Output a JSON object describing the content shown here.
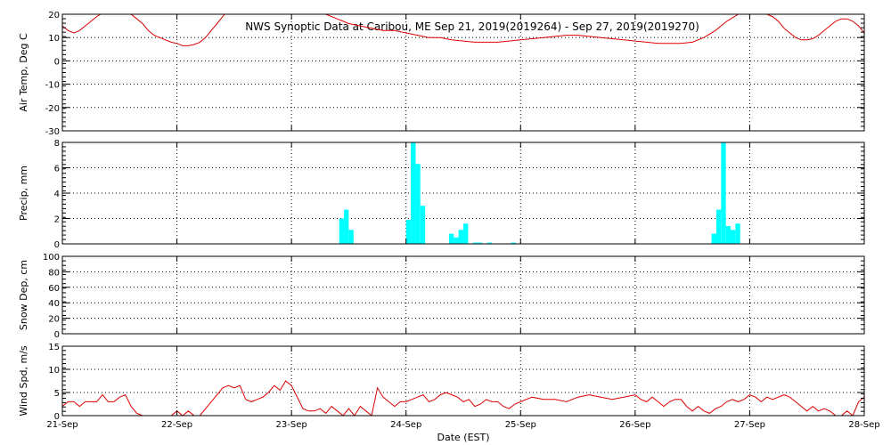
{
  "chart_data": {
    "type": "multi-panel-timeseries",
    "title": "NWS Synoptic Data at Caribou, ME   Sep 21, 2019(2019264) - Sep 27, 2019(2019270)",
    "xlabel": "Date (EST)",
    "x_unit": "days after 21-Sep 00:00",
    "xlim": [
      0,
      7
    ],
    "x_ticks": [
      0,
      1,
      2,
      3,
      4,
      5,
      6,
      7
    ],
    "x_tick_labels": [
      "21-Sep",
      "22-Sep",
      "23-Sep",
      "24-Sep",
      "25-Sep",
      "26-Sep",
      "27-Sep",
      "28-Sep"
    ],
    "colors": {
      "temperature": "#dd0000",
      "wind": "#dd0000",
      "precip": "#00ffff",
      "axes": "#000000"
    },
    "grid": "dotted",
    "panels": [
      {
        "id": "air-temp",
        "type": "line",
        "ylabel": "Air Temp, Deg C",
        "ylim": [
          -30,
          20
        ],
        "yticks": [
          -30,
          -20,
          -10,
          0,
          10,
          20
        ],
        "ytick_labels": [
          "-30",
          "-20",
          "-10",
          "0",
          "10",
          "20"
        ],
        "x": [
          0,
          0.05,
          0.1,
          0.15,
          0.2,
          0.25,
          0.3,
          0.35,
          0.4,
          0.45,
          0.5,
          0.55,
          0.6,
          0.65,
          0.7,
          0.75,
          0.8,
          0.85,
          0.9,
          0.95,
          1,
          1.05,
          1.1,
          1.15,
          1.2,
          1.25,
          1.3,
          1.35,
          1.4,
          1.45,
          1.5,
          1.55,
          1.6,
          1.65,
          1.7,
          1.75,
          1.8,
          1.85,
          1.9,
          1.95,
          2,
          2.1,
          2.2,
          2.3,
          2.4,
          2.5,
          2.6,
          2.7,
          2.8,
          2.9,
          3,
          3.1,
          3.2,
          3.3,
          3.4,
          3.5,
          3.6,
          3.7,
          3.8,
          3.9,
          4,
          4.1,
          4.2,
          4.3,
          4.4,
          4.5,
          4.6,
          4.7,
          4.8,
          4.9,
          5,
          5.1,
          5.2,
          5.3,
          5.4,
          5.5,
          5.6,
          5.7,
          5.8,
          5.9,
          6,
          6.05,
          6.1,
          6.15,
          6.2,
          6.25,
          6.3,
          6.35,
          6.4,
          6.45,
          6.5,
          6.55,
          6.6,
          6.65,
          6.7,
          6.75,
          6.8,
          6.85,
          6.9,
          6.95,
          7
        ],
        "y": [
          15,
          13,
          12,
          13,
          15,
          17,
          19,
          20.5,
          21,
          21.5,
          22,
          21,
          20,
          18,
          16,
          13,
          11,
          10,
          9,
          8,
          7.5,
          6.5,
          6.5,
          7,
          8,
          10,
          13,
          16,
          19,
          22,
          24,
          25,
          24,
          23,
          22,
          21,
          21,
          22,
          23,
          24,
          25,
          24,
          22,
          20,
          18,
          16,
          15,
          14,
          13,
          13,
          12,
          11,
          10,
          10,
          9,
          8.5,
          8,
          8,
          8,
          8.5,
          9,
          9.5,
          10,
          10.5,
          11,
          11,
          10.5,
          10,
          9.5,
          9,
          8.5,
          8,
          7.5,
          7.5,
          7.5,
          8,
          10,
          13,
          17,
          20,
          22,
          22,
          21,
          20,
          19,
          17,
          14,
          12,
          10,
          9,
          9,
          9.5,
          11,
          13,
          15,
          17,
          18,
          18,
          17,
          15,
          12,
          10,
          9,
          8,
          8.5
        ]
      },
      {
        "id": "precip",
        "type": "bar",
        "ylabel": "Precip, mm",
        "ylim": [
          0,
          8
        ],
        "yticks": [
          0,
          2,
          4,
          6,
          8
        ],
        "ytick_labels": [
          "0",
          "2",
          "4",
          "6",
          "8"
        ],
        "bar_width_days": 0.0417,
        "x": [
          2.417,
          2.458,
          2.5,
          3.0,
          3.042,
          3.083,
          3.125,
          3.375,
          3.417,
          3.458,
          3.5,
          3.583,
          3.625,
          3.708,
          3.917,
          5.667,
          5.708,
          5.75,
          5.792,
          5.833,
          5.875
        ],
        "values": [
          2.0,
          2.7,
          1.1,
          1.9,
          8.7,
          6.3,
          3.0,
          0.8,
          0.5,
          1.1,
          1.6,
          0.1,
          0.1,
          0.1,
          0.1,
          0.8,
          2.7,
          9.3,
          1.4,
          1.1,
          1.6
        ]
      },
      {
        "id": "snow-depth",
        "type": "line",
        "ylabel": "Snow Dep, cm",
        "ylim": [
          0,
          100
        ],
        "yticks": [
          0,
          20,
          40,
          60,
          80,
          100
        ],
        "ytick_labels": [
          "0",
          "20",
          "40",
          "60",
          "80",
          "100"
        ],
        "x": [],
        "y": []
      },
      {
        "id": "wind-speed",
        "type": "line",
        "ylabel": "Wind Spd, m/s",
        "ylim": [
          0,
          15
        ],
        "yticks": [
          0,
          5,
          10,
          15
        ],
        "ytick_labels": [
          "0",
          "5",
          "10",
          "15"
        ],
        "x": [
          0,
          0.05,
          0.1,
          0.15,
          0.2,
          0.25,
          0.3,
          0.35,
          0.4,
          0.45,
          0.5,
          0.55,
          0.6,
          0.65,
          0.7,
          0.75,
          0.8,
          0.85,
          0.9,
          0.95,
          1,
          1.05,
          1.1,
          1.15,
          1.2,
          1.25,
          1.3,
          1.35,
          1.4,
          1.45,
          1.5,
          1.55,
          1.6,
          1.65,
          1.7,
          1.75,
          1.8,
          1.85,
          1.9,
          1.95,
          2,
          2.05,
          2.1,
          2.15,
          2.2,
          2.25,
          2.3,
          2.35,
          2.4,
          2.45,
          2.5,
          2.55,
          2.6,
          2.65,
          2.7,
          2.75,
          2.8,
          2.85,
          2.9,
          2.95,
          3,
          3.05,
          3.1,
          3.15,
          3.2,
          3.25,
          3.3,
          3.35,
          3.4,
          3.45,
          3.5,
          3.55,
          3.6,
          3.65,
          3.7,
          3.75,
          3.8,
          3.85,
          3.9,
          3.95,
          4,
          4.1,
          4.2,
          4.3,
          4.4,
          4.5,
          4.6,
          4.7,
          4.8,
          4.9,
          5,
          5.05,
          5.1,
          5.15,
          5.2,
          5.25,
          5.3,
          5.35,
          5.4,
          5.45,
          5.5,
          5.55,
          5.6,
          5.65,
          5.7,
          5.75,
          5.8,
          5.85,
          5.9,
          5.95,
          6,
          6.05,
          6.1,
          6.15,
          6.2,
          6.25,
          6.3,
          6.35,
          6.4,
          6.45,
          6.5,
          6.55,
          6.6,
          6.65,
          6.7,
          6.75,
          6.8,
          6.85,
          6.9,
          6.95,
          7
        ],
        "y": [
          2,
          3,
          3,
          2,
          3,
          3,
          3,
          4.5,
          3,
          3,
          4,
          4.5,
          2,
          0.5,
          0,
          0,
          0,
          0,
          0,
          0,
          1,
          0,
          1,
          0,
          0,
          1.5,
          3,
          4.5,
          6,
          6.5,
          6,
          6.5,
          3.5,
          3,
          3.5,
          4,
          5,
          6.5,
          5.5,
          7.5,
          6.5,
          4,
          1.5,
          1,
          1,
          1.5,
          0.5,
          2,
          1,
          0,
          1.5,
          0,
          2,
          1,
          0,
          6,
          4,
          3,
          2,
          3,
          3,
          3.5,
          4,
          4.5,
          3,
          3.5,
          4.5,
          5,
          4.5,
          4,
          3,
          3.5,
          2,
          2.5,
          3.5,
          3,
          3,
          2,
          1.5,
          2.5,
          3,
          4,
          3.5,
          3.5,
          3,
          4,
          4.5,
          4,
          3.5,
          4,
          4.5,
          3.5,
          3,
          4,
          3,
          2,
          3,
          3.5,
          3.5,
          2,
          1,
          2,
          1,
          0.5,
          1.5,
          2,
          3,
          3.5,
          3,
          3.5,
          4.5,
          4,
          3,
          4,
          3.5,
          4,
          4.5,
          4,
          3,
          2,
          1,
          2,
          1,
          1.5,
          1,
          0,
          0,
          1,
          0,
          3,
          4,
          3.5,
          4.5,
          4
        ]
      }
    ]
  }
}
